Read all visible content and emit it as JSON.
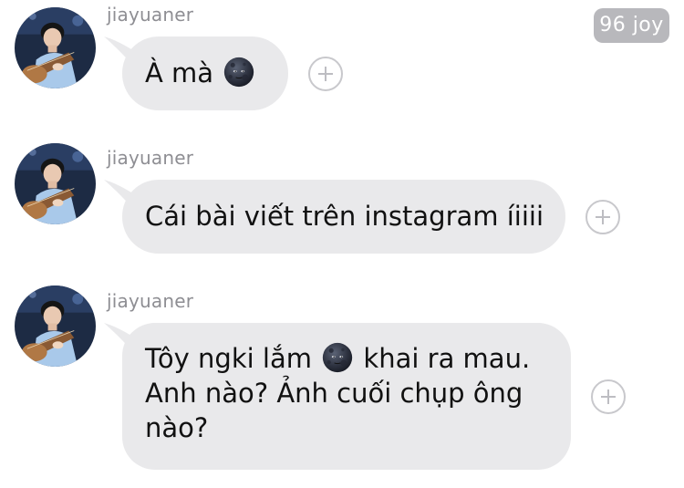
{
  "badge": {
    "label": "96 joy"
  },
  "messages": [
    {
      "sender": "jiayuaner",
      "parts": [
        "À mà",
        ""
      ],
      "emoji": "new-moon-face-icon"
    },
    {
      "sender": "jiayuaner",
      "text": "Cái bài viết trên instagram íiiii"
    },
    {
      "sender": "jiayuaner",
      "line1_before": "Tôy ngki lắm",
      "line1_after": "khai ra mau.",
      "line2": "Anh nào? Ảnh cuối chụp ông",
      "line3": "nào?",
      "emoji": "new-moon-face-icon"
    }
  ],
  "colors": {
    "bubble": "#e9e9eb",
    "sender": "#8e8e93",
    "badge": "#b8b8bc"
  }
}
